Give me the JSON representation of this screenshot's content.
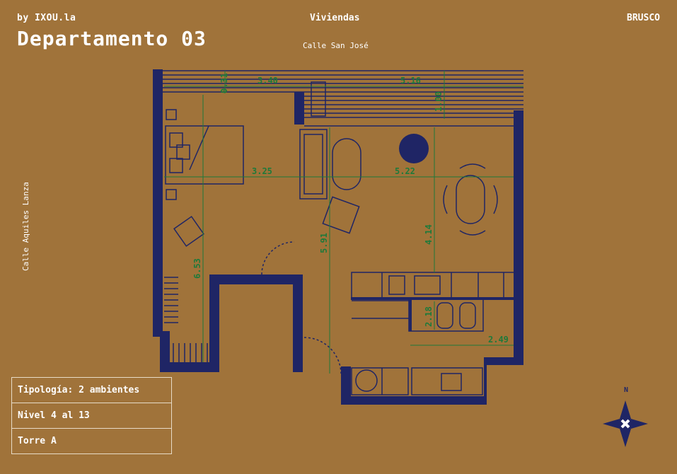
{
  "header": {
    "brand": "by IXOU.la",
    "title": "Departamento 03",
    "category": "Viviendas",
    "street_top": "Calle San José",
    "client": "BRUSCO"
  },
  "street_side": "Calle Aquiles Lanza",
  "info": {
    "rows": [
      "Tipología: 2 ambientes",
      "Nivel 4 al 13",
      "Torre A"
    ]
  },
  "plan": {
    "dimensions": [
      "0.31",
      "3.40",
      "5.16",
      "1.00",
      "3.25",
      "5.22",
      "5.91",
      "4.14",
      "6.53",
      "2.18",
      "2.49"
    ]
  },
  "compass": {
    "label": "N"
  },
  "colors": {
    "background": "#a0733a",
    "wall": "#1f2565",
    "dimension": "#1e7a3a",
    "text": "#ffffff"
  }
}
